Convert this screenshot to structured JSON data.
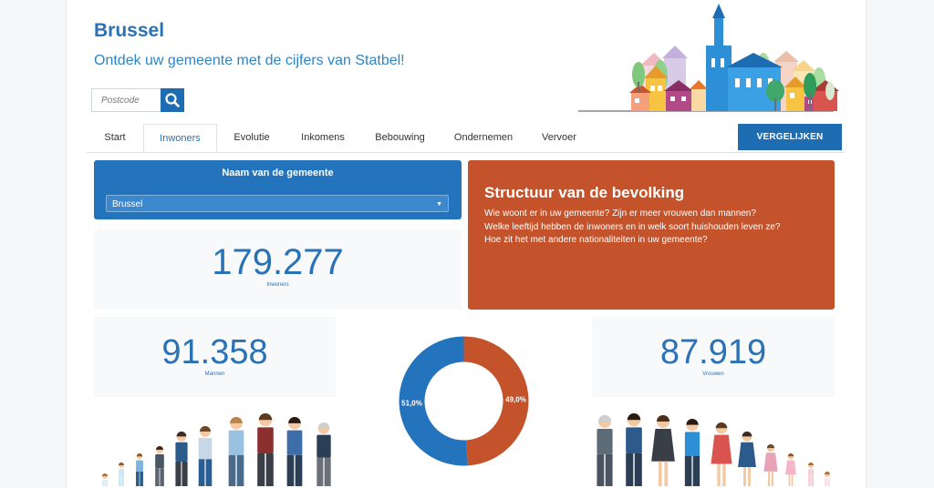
{
  "header": {
    "title": "Brussel",
    "subtitle": "Ontdek uw gemeente met de cijfers van Statbel!"
  },
  "search": {
    "placeholder": "Postcode",
    "button_icon": "search-icon"
  },
  "tabs": [
    {
      "label": "Start",
      "active": false
    },
    {
      "label": "Inwoners",
      "active": true
    },
    {
      "label": "Evolutie",
      "active": false
    },
    {
      "label": "Inkomens",
      "active": false
    },
    {
      "label": "Bebouwing",
      "active": false
    },
    {
      "label": "Ondernemen",
      "active": false
    },
    {
      "label": "Vervoer",
      "active": false
    }
  ],
  "compare_button": "VERGELIJKEN",
  "municipality_select": {
    "label": "Naam van de gemeente",
    "value": "Brussel"
  },
  "info": {
    "title": "Structuur van de bevolking",
    "lines": [
      "Wie woont er in uw gemeente?  Zijn er meer vrouwen dan mannen?",
      "Welke leeftijd hebben de inwoners en in welk soort huishouden leven ze?",
      "Hoe zit het met andere nationaliteiten in uw gemeente?"
    ]
  },
  "stats": {
    "total": {
      "value": "179.277",
      "label": "Inwoners"
    },
    "men": {
      "value": "91.358",
      "label": "Mannen"
    },
    "women": {
      "value": "87.919",
      "label": "Vrouwen"
    }
  },
  "chart_data": {
    "type": "pie",
    "categories": [
      "Mannen",
      "Vrouwen"
    ],
    "values": [
      51.0,
      49.0
    ],
    "labels": [
      "51,0%",
      "49,0%"
    ],
    "colors": [
      "#2473bd",
      "#c4532b"
    ]
  },
  "colors": {
    "accent_blue": "#2473bd",
    "accent_orange": "#c4532b",
    "text_blue": "#2a72b5"
  }
}
